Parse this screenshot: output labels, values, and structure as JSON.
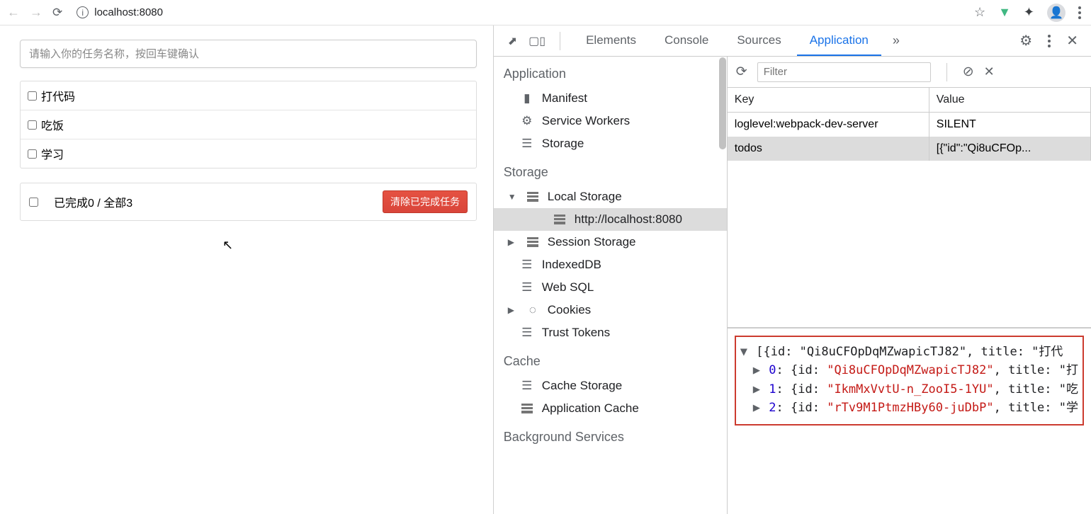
{
  "browser": {
    "url": "localhost:8080"
  },
  "todo": {
    "placeholder": "请输入你的任务名称，按回车键确认",
    "items": [
      "打代码",
      "吃饭",
      "学习"
    ],
    "summary": "已完成0 / 全部3",
    "clear_btn": "清除已完成任务"
  },
  "devtools": {
    "tabs": [
      "Elements",
      "Console",
      "Sources",
      "Application"
    ],
    "active_tab": "Application",
    "sidebar": {
      "application": {
        "title": "Application",
        "items": [
          "Manifest",
          "Service Workers",
          "Storage"
        ]
      },
      "storage": {
        "title": "Storage",
        "local_storage": "Local Storage",
        "local_host": "http://localhost:8080",
        "session_storage": "Session Storage",
        "indexeddb": "IndexedDB",
        "websql": "Web SQL",
        "cookies": "Cookies",
        "trust_tokens": "Trust Tokens"
      },
      "cache": {
        "title": "Cache",
        "items": [
          "Cache Storage",
          "Application Cache"
        ]
      },
      "bg": {
        "title": "Background Services"
      }
    },
    "filter_placeholder": "Filter",
    "grid": {
      "head_key": "Key",
      "head_val": "Value",
      "rows": [
        {
          "key": "loglevel:webpack-dev-server",
          "val": "SILENT"
        },
        {
          "key": "todos",
          "val": "[{\"id\":\"Qi8uCFOp..."
        }
      ],
      "selected": 1
    },
    "preview": {
      "root": "[{id: \"Qi8uCFOpDqMZwapicTJ82\", title: \"打代",
      "items": [
        {
          "idx": "0",
          "id": "Qi8uCFOpDqMZwapicTJ82",
          "tail": "title: \"打"
        },
        {
          "idx": "1",
          "id": "IkmMxVvtU-n_ZooI5-1YU",
          "tail": "title: \"吃"
        },
        {
          "idx": "2",
          "id": "rTv9M1PtmzHBy60-juDbP",
          "tail": "title: \"学"
        }
      ]
    }
  }
}
